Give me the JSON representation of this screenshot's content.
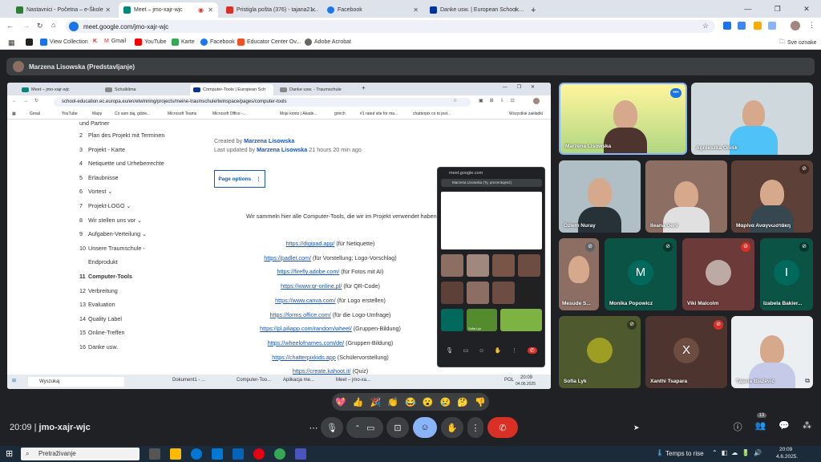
{
  "browser": {
    "tabs": [
      {
        "label": "Nastavnici - Početna – e-Škole",
        "color": "#2e7d32"
      },
      {
        "label": "Meet – jmo-xajr-wjc",
        "color": "#00897b"
      },
      {
        "label": "Pristigla pošta (376) - tajana21…",
        "color": "#d93025"
      },
      {
        "label": "Facebook",
        "color": "#1877f2"
      },
      {
        "label": "Danke usw. | European School …",
        "color": "#003399"
      }
    ],
    "url": "meet.google.com/jmo-xajr-wjc",
    "bookmarks": [
      "View Collection",
      "Gmail",
      "YouTube",
      "Karte",
      "Facebook",
      "Educator Center Ov...",
      "Adobe Acrobat"
    ],
    "all_bookmarks": "Sve oznake"
  },
  "meet": {
    "presenter_label": "Marzena Lisowska (Predstavljanje)",
    "clock": "20:09",
    "meeting_code": "jmo-xajr-wjc",
    "participant_count": "13",
    "reactions": [
      "💖",
      "👍",
      "🎉",
      "👏",
      "😂",
      "😮",
      "😢",
      "🤔",
      "👎"
    ]
  },
  "shared": {
    "tabs": [
      "Meet – jmo-xajr-wjc",
      "Schulklima",
      "Computer-Tools | European Sch",
      "Danke usw. - Traumschule"
    ],
    "url": "school-education.ec.europa.eu/en/etwinning/projects/meine-traumschule/twinspace/pages/computer-tools",
    "bookmarks": [
      "Gmail",
      "YouTube",
      "Mapy",
      "Co sam daj, gdzie...",
      "Microsoft Teams",
      "Microsoft Office -...",
      "Moje konto | Akade...",
      "grinch",
      "#1 rated site for ma...",
      "chatterpix co to jest...",
      "Wszystkie zakładki"
    ],
    "toc_partial": "und Partner",
    "toc": [
      {
        "num": "2",
        "label": "Plan des Projekt mit Terminen"
      },
      {
        "num": "3",
        "label": "Projekt - Karte"
      },
      {
        "num": "4",
        "label": "Netiquette und Urheberrechte"
      },
      {
        "num": "5",
        "label": "Erlaubnisse"
      },
      {
        "num": "6",
        "label": "Vortest"
      },
      {
        "num": "7",
        "label": "Projekt-LOGO"
      },
      {
        "num": "8",
        "label": "Wir stellen uns vor"
      },
      {
        "num": "9",
        "label": "Aufgaben-Verteilung"
      },
      {
        "num": "10",
        "label": "Unsere Traumschule -"
      },
      {
        "num": "",
        "label": "Endprodukt"
      },
      {
        "num": "11",
        "label": "Computer-Tools"
      },
      {
        "num": "12",
        "label": "Verbreitung"
      },
      {
        "num": "13",
        "label": "Evaluation"
      },
      {
        "num": "14",
        "label": "Quality Label"
      },
      {
        "num": "15",
        "label": "Online-Treffen"
      },
      {
        "num": "16",
        "label": "Danke usw."
      }
    ],
    "created_by_label": "Created by",
    "author": "Marzena Lisowska",
    "updated_label": "Last updated by",
    "updated_ago": "21 hours 20 min ago",
    "page_options": "Page options",
    "intro": "Wir sammeln hier alle Computer-Tools, die wir im Projekt verwendet haben:",
    "links": [
      {
        "url": "https://digipad.app/",
        "note": "(für Netiquette)"
      },
      {
        "url": "https://padlet.com/",
        "note": "(für Vorstellung; Logo-Vorschlag)"
      },
      {
        "url": "https://firefly.adobe.com/",
        "note": "(für Fotos mit AI)"
      },
      {
        "url": "https://www.qr-online.pl/",
        "note": "(für QR-Code)"
      },
      {
        "url": "https://www.canva.com/",
        "note": "(für Logo erstellen)"
      },
      {
        "url": "https://forms.office.com/",
        "note": "(für die Logo-Umfrage)"
      },
      {
        "url": "https://pl.piliapp.com/random/wheel/",
        "note": "(Gruppen-Bildung)"
      },
      {
        "url": "https://wheelofnames.com/de/",
        "note": "(Gruppen-Bildung)"
      },
      {
        "url": "https://chatterpixkids.app",
        "note": "(Schülervorstellung)"
      },
      {
        "url": "https://create.kahoot.it/",
        "note": "(Quiz)"
      }
    ],
    "taskbar": {
      "search": "Wyszukaj",
      "apps": [
        "Dokument1 - ...",
        "Computer-Too...",
        "Aplikacja me...",
        "Meet – jmo-xa..."
      ],
      "lang": "POL",
      "time": "20:09",
      "date": "04.06.2025"
    },
    "mini_popup": {
      "url": "meet.google.com",
      "presenting": "Marzena Lisowska (Ty, prezentujesz)",
      "tile_name": "Sofia Lyk"
    }
  },
  "participants": [
    {
      "name": "Marzena Lisowska",
      "muted": false
    },
    {
      "name": "Agnieszka Oniśk",
      "muted": false
    },
    {
      "name": "Özlem Nuray",
      "muted": false
    },
    {
      "name": "Ileana Geni",
      "muted": false
    },
    {
      "name": "Μαρίνα Αναγνωστάκη",
      "muted": false
    },
    {
      "name": "Mesude S...",
      "muted": true
    },
    {
      "name": "Monika Popowicz",
      "muted": true,
      "letter": "M",
      "color": "#00695c"
    },
    {
      "name": "Viki Malcolm",
      "muted": true
    },
    {
      "name": "Izabela Bakier...",
      "muted": true,
      "letter": "I",
      "color": "#00695c"
    },
    {
      "name": "Sofia Lyk",
      "muted": true
    },
    {
      "name": "Xanthi Tsapara",
      "muted": true,
      "letter": "X",
      "color": "#6d4c41"
    },
    {
      "name": "Tajana Blažević",
      "muted": false
    }
  ],
  "windows": {
    "search": "Pretraživanje",
    "weather": "Temps to rise",
    "time": "20:09",
    "date": "4.6.2025."
  }
}
